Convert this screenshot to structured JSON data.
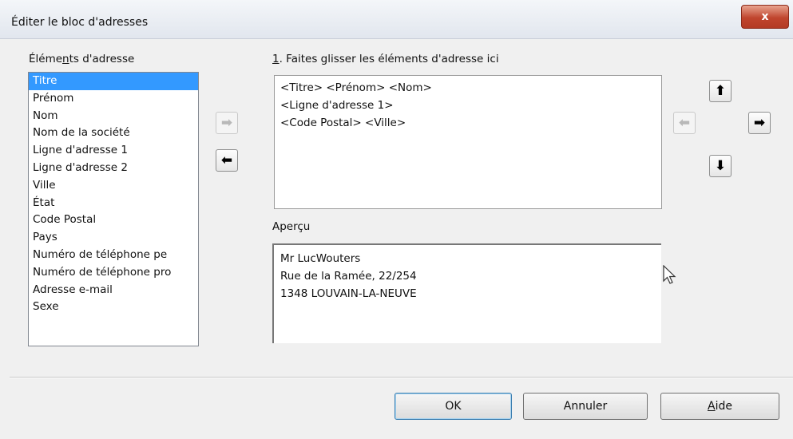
{
  "window": {
    "title": "Éditer le bloc d'adresses",
    "close_label": "x"
  },
  "elements": {
    "label": "Éléments d'adresse",
    "label_mnemonic": "n",
    "items": [
      "Titre",
      "Prénom",
      "Nom",
      "Nom de la société",
      "Ligne d'adresse 1",
      "Ligne d'adresse 2",
      "Ville",
      "État",
      "Code Postal",
      "Pays",
      "Numéro de téléphone pe",
      "Numéro de téléphone pro",
      "Adresse e-mail",
      "Sexe"
    ],
    "selected_index": 0
  },
  "drag_area": {
    "label_number": "1",
    "label_text": ". Faites glisser les éléments d'adresse ici",
    "lines": [
      "<Titre> <Prénom> <Nom>",
      "<Ligne d'adresse 1>",
      "<Code Postal> <Ville>"
    ]
  },
  "preview": {
    "label": "Aperçu",
    "lines": [
      "Mr LucWouters",
      "Rue de la Ramée, 22/254",
      "1348 LOUVAIN-LA-NEUVE"
    ]
  },
  "arrows": {
    "add": "➡",
    "remove": "⬅",
    "up": "⬆",
    "left": "⬅",
    "right": "➡",
    "down": "⬇"
  },
  "buttons": {
    "ok": "OK",
    "cancel": "Annuler",
    "help_mnemonic": "A",
    "help_rest": "ide"
  },
  "colors": {
    "selection": "#3399ff",
    "close_button": "#c0452e",
    "disabled_arrow": "#b8b8b8"
  }
}
